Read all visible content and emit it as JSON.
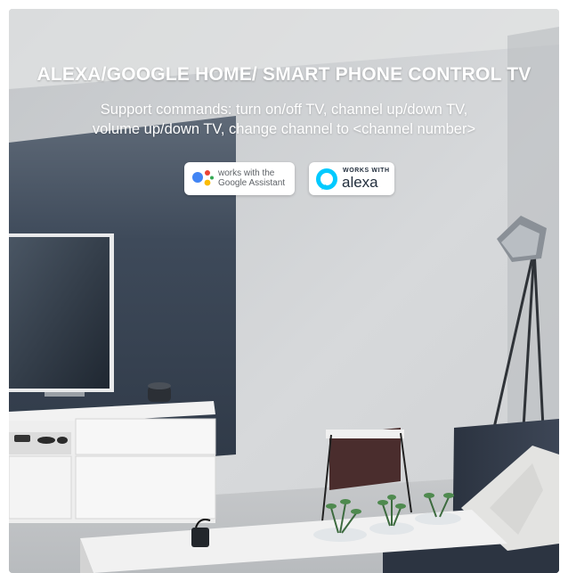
{
  "banner": {
    "headline": "ALEXA/GOOGLE HOME/ SMART PHONE CONTROL TV",
    "subtitle_line1": "Support commands: turn on/off TV, channel up/down TV,",
    "subtitle_line2": "volume up/down TV, change channel to <channel number>"
  },
  "badges": {
    "google": {
      "line1": "works with the",
      "line2": "Google Assistant",
      "icon": "google-assistant-icon"
    },
    "alexa": {
      "top": "WORKS WITH",
      "word": "alexa",
      "icon": "alexa-ring-icon"
    }
  },
  "colors": {
    "wall_dark": "#3b4656",
    "wall_light": "#c9cbcd",
    "floor": "#cfd1d3",
    "alexa_blue": "#00caff",
    "google_blue": "#4285f4",
    "google_red": "#ea4335",
    "google_yellow": "#fbbc05",
    "google_green": "#34a853"
  }
}
